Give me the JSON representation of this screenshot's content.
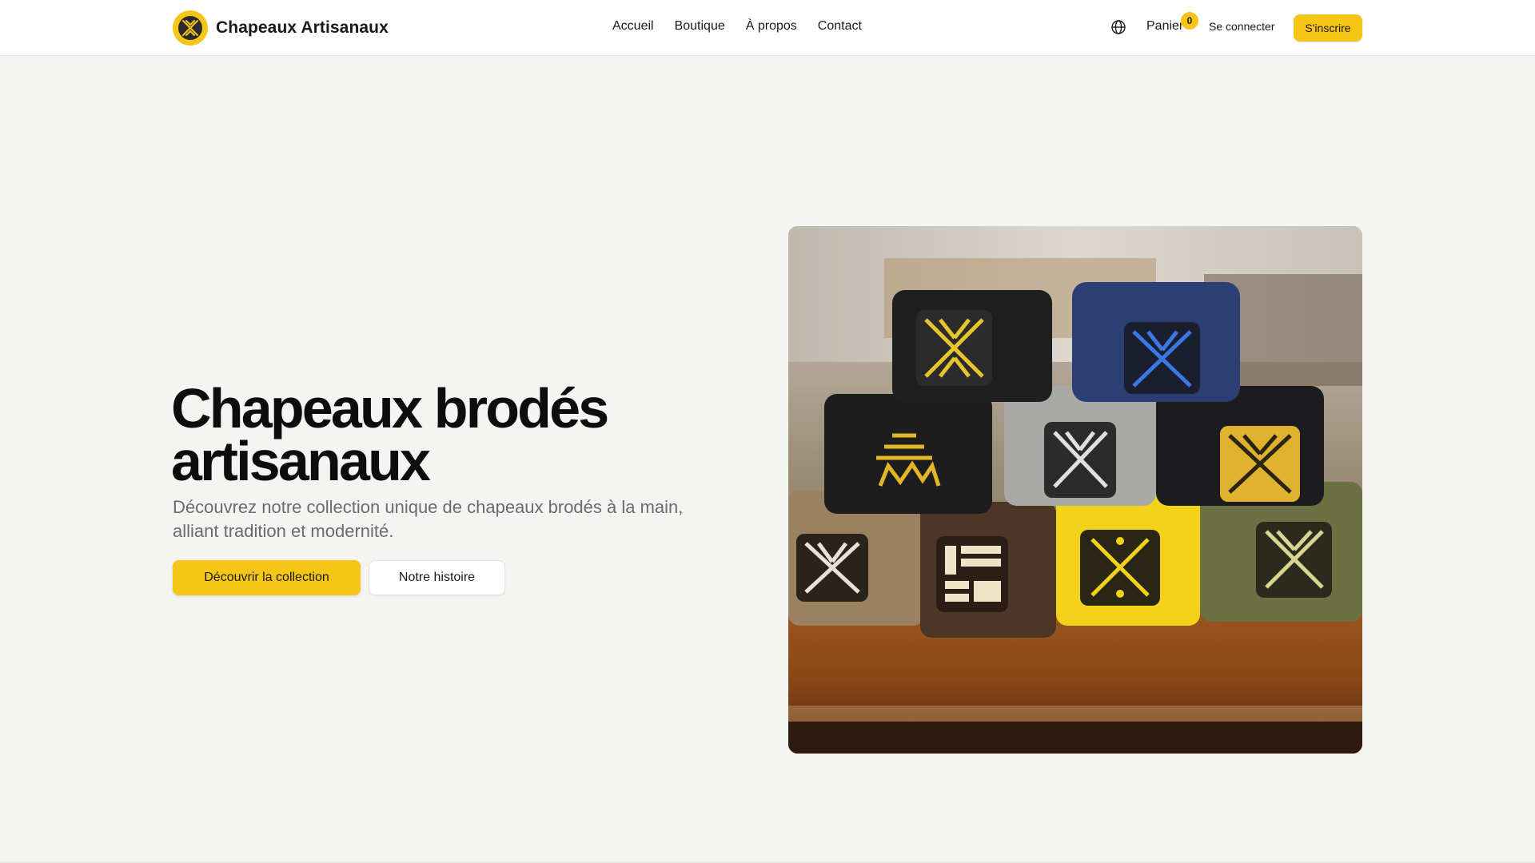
{
  "brand": {
    "name": "Chapeaux Artisanaux",
    "logo_icon": "embroidered-x-logo-icon",
    "accent_color": "#f5c518"
  },
  "nav": {
    "items": [
      {
        "label": "Accueil"
      },
      {
        "label": "Boutique"
      },
      {
        "label": "À propos"
      },
      {
        "label": "Contact"
      }
    ]
  },
  "header_actions": {
    "language_icon": "globe-icon",
    "cart_label": "Panier",
    "cart_count": "0",
    "login_label": "Se connecter",
    "signup_label": "S'inscrire"
  },
  "hero": {
    "title": "Chapeaux brodés artisanaux",
    "subtitle": "Découvrez notre collection unique de chapeaux brodés à la main, alliant tradition et modernité.",
    "primary_cta": "Découvrir la collection",
    "secondary_cta": "Notre histoire",
    "image_alt": "embroidered-hats-photo"
  }
}
